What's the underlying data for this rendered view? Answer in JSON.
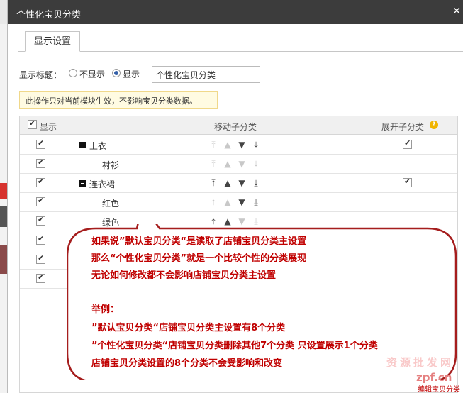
{
  "window": {
    "title": "个性化宝贝分类"
  },
  "tabs": [
    {
      "label": "显示设置"
    }
  ],
  "display_title": {
    "label": "显示标题：",
    "options": [
      {
        "label": "不显示",
        "checked": false
      },
      {
        "label": "显示",
        "checked": true
      }
    ],
    "input_value": "个性化宝贝分类"
  },
  "notice": "此操作只对当前模块生效，不影响宝贝分类数据。",
  "table": {
    "headers": {
      "show": "显示",
      "move": "移动子分类",
      "expand": "展开子分类"
    },
    "rows": [
      {
        "name": "上衣",
        "level": 0,
        "show": true,
        "expand": true,
        "collapsible": true
      },
      {
        "name": "衬衫",
        "level": 1,
        "show": true,
        "expand": false,
        "collapsible": false
      },
      {
        "name": "连衣裙",
        "level": 0,
        "show": true,
        "expand": true,
        "collapsible": true
      },
      {
        "name": "红色",
        "level": 1,
        "show": true,
        "expand": false,
        "collapsible": false
      },
      {
        "name": "绿色",
        "level": 1,
        "show": true,
        "expand": false,
        "collapsible": false
      },
      {
        "name": "",
        "level": 1,
        "show": true,
        "expand": false,
        "collapsible": false
      },
      {
        "name": "",
        "level": 1,
        "show": true,
        "expand": false,
        "collapsible": false
      },
      {
        "name": "",
        "level": 1,
        "show": true,
        "expand": false,
        "collapsible": false
      }
    ]
  },
  "annotation": {
    "lines": [
      "如果说”默认宝贝分类“是读取了店铺宝贝分类主设置",
      "那么“个性化宝贝分类”就是一个比较个性的分类展现",
      "无论如何修改都不会影响店铺宝贝分类主设置",
      "",
      "举例：",
      "”默认宝贝分类“店铺宝贝分类主设置有8个分类",
      "”个性化宝贝分类“店铺宝贝分类删除其他7个分类 只设置展示1个分类",
      "店铺宝贝分类设置的8个分类不会受影响和改变"
    ]
  },
  "watermark": {
    "line1": "资源批发网",
    "line2": "zpf.cn",
    "line3": "编辑宝贝分类"
  },
  "colors": {
    "titlebar": "#3c3c3c",
    "annotation_text": "#c00000",
    "bubble_border": "#a51d1d",
    "radio_checked": "#335fa8"
  }
}
